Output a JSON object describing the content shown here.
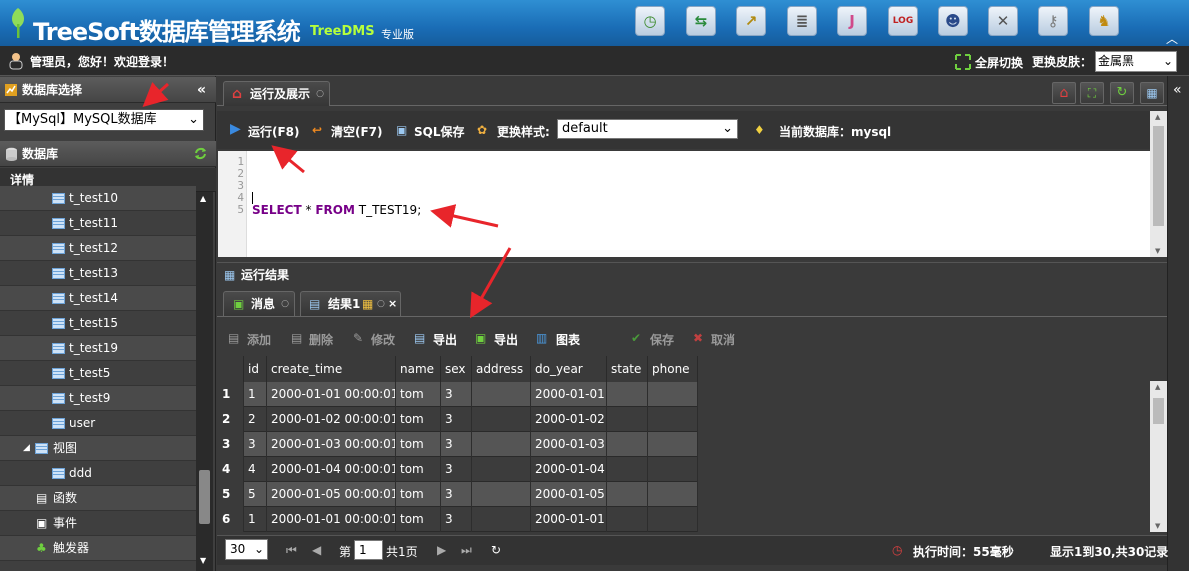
{
  "header": {
    "title": "TreeSoft数据库管理系统",
    "subtitle": "TreeDMS",
    "edition": "专业版",
    "toolbar_icons": [
      "clock-icon",
      "sync-arrows-icon",
      "chart-icon",
      "database-icon",
      "j-icon",
      "log-icon",
      "user-admin-icon",
      "tools-icon",
      "key-icon",
      "person-icon"
    ],
    "collapse": "︿"
  },
  "welcome": {
    "text": "管理员，您好！欢迎登录！",
    "fullscreen": "全屏切换",
    "skin_label": "更换皮肤：",
    "skin_value": "金属黑"
  },
  "left": {
    "db_select_title": "数据库选择",
    "db_select_value": "【MySql】MySQL数据库",
    "db_title": "数据库",
    "detail": "详情",
    "tables": [
      "t_test10",
      "t_test11",
      "t_test12",
      "t_test13",
      "t_test14",
      "t_test15",
      "t_test19",
      "t_test5",
      "t_test9",
      "user"
    ],
    "views_label": "视图",
    "view_items": [
      "ddd"
    ],
    "functions": "函数",
    "events": "事件",
    "triggers": "触发器"
  },
  "main": {
    "tab_label": "运行及展示",
    "toolbar": {
      "run": "运行(F8)",
      "clear": "清空(F7)",
      "save": "SQL保存",
      "style_label": "更换样式:",
      "style_value": "default",
      "current_db": "当前数据库：mysql"
    },
    "editor": {
      "line_numbers": [
        "1",
        "2",
        "3",
        "4",
        "5"
      ],
      "kw1": "SELECT",
      "star": " * ",
      "kw2": "FROM",
      "rest": " T_TEST19;"
    },
    "results_title": "运行结果",
    "result_tabs": {
      "message": "消息",
      "result1": "结果1"
    },
    "result_toolbar": {
      "add": "添加",
      "delete": "删除",
      "edit": "修改",
      "export1": "导出",
      "export2": "导出",
      "chart": "图表",
      "save": "保存",
      "cancel": "取消"
    },
    "columns": [
      "id",
      "create_time",
      "name",
      "sex",
      "address",
      "do_year",
      "state",
      "phone"
    ],
    "rows": [
      [
        "1",
        "1",
        "2000-01-01 00:00:01",
        "tom",
        "3",
        "",
        "2000-01-01",
        "",
        ""
      ],
      [
        "2",
        "2",
        "2000-01-02 00:00:01",
        "tom",
        "3",
        "",
        "2000-01-02",
        "",
        ""
      ],
      [
        "3",
        "3",
        "2000-01-03 00:00:01",
        "tom",
        "3",
        "",
        "2000-01-03",
        "",
        ""
      ],
      [
        "4",
        "4",
        "2000-01-04 00:00:01",
        "tom",
        "3",
        "",
        "2000-01-04",
        "",
        ""
      ],
      [
        "5",
        "5",
        "2000-01-05 00:00:01",
        "tom",
        "3",
        "",
        "2000-01-05",
        "",
        ""
      ],
      [
        "6",
        "1",
        "2000-01-01 00:00:01",
        "tom",
        "3",
        "",
        "2000-01-01",
        "",
        ""
      ]
    ],
    "pager": {
      "page_size": "30",
      "page_prefix": "第",
      "page_value": "1",
      "page_suffix": "共1页",
      "exec_time": "执行时间：55毫秒",
      "summary": "显示1到30,共30记录"
    }
  },
  "colors": {
    "header_blue": "#1a6db6",
    "arrow_red": "#e8252b",
    "keyword": "#770088"
  }
}
